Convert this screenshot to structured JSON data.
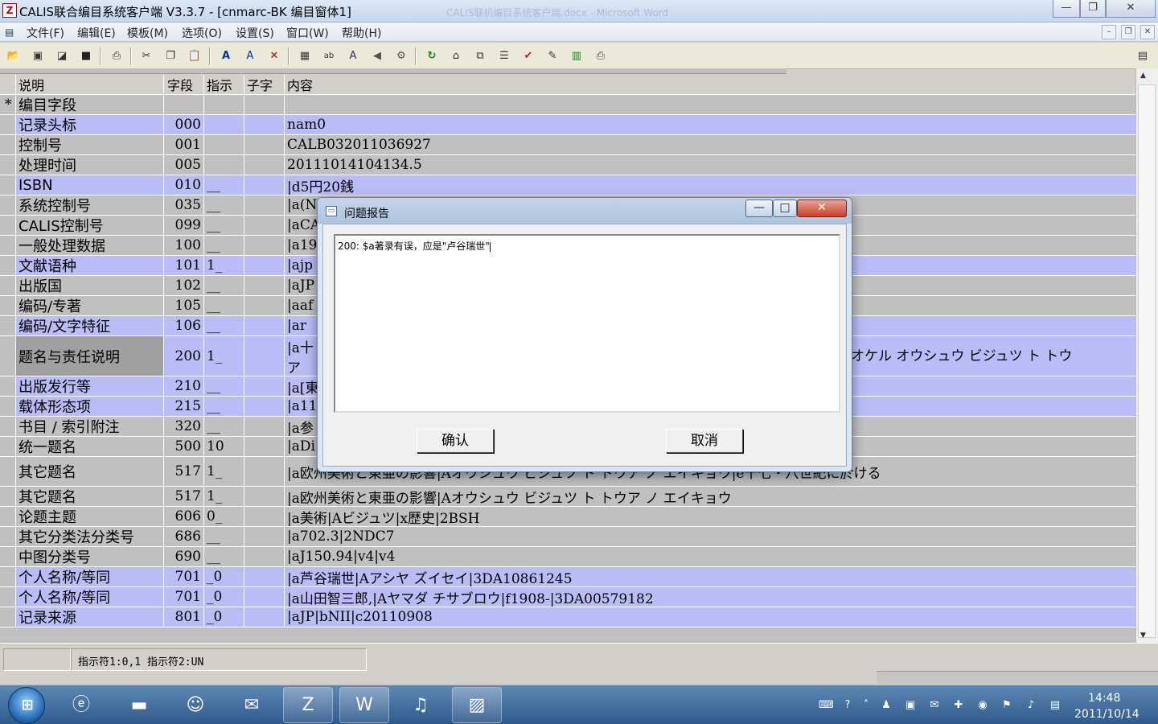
{
  "window": {
    "title": "CALIS联合编目系统客户端 V3.3.7 - [cnmarc-BK 编目窗体1]",
    "ghost_title": "CALIS联机编目系统客户端.docx - Microsoft Word",
    "minimize": "—",
    "maximize": "❐",
    "close": "✕"
  },
  "menu": {
    "items": [
      "文件(F)",
      "编辑(E)",
      "模板(M)",
      "选项(O)",
      "设置(S)",
      "窗口(W)",
      "帮助(H)"
    ]
  },
  "grid": {
    "headers": {
      "ind": "",
      "desc": "说明",
      "field": "字段",
      "indicator": "指示",
      "sub": "子字",
      "content": "内容"
    },
    "rows": [
      {
        "mark": "*",
        "desc": "编目字段",
        "field": "",
        "indicator": "",
        "sub": "",
        "content": "",
        "style": "gray"
      },
      {
        "mark": "",
        "desc": "记录头标",
        "field": "000",
        "indicator": "",
        "sub": "",
        "content": "nam0",
        "style": "blue"
      },
      {
        "mark": "",
        "desc": "控制号",
        "field": "001",
        "indicator": "",
        "sub": "",
        "content": "CALB032011036927",
        "style": "gray"
      },
      {
        "mark": "",
        "desc": "处理时间",
        "field": "005",
        "indicator": "",
        "sub": "",
        "content": "20111014104134.5",
        "style": "gray"
      },
      {
        "mark": "",
        "desc": "ISBN",
        "field": "010",
        "indicator": "__",
        "sub": "",
        "content": "|d5円20銭",
        "style": "blue"
      },
      {
        "mark": "",
        "desc": "系统控制号",
        "field": "035",
        "indicator": "__",
        "sub": "",
        "content": "|a(N",
        "style": "gray"
      },
      {
        "mark": "",
        "desc": "CALIS控制号",
        "field": "099",
        "indicator": "__",
        "sub": "",
        "content": "|aCA",
        "style": "gray"
      },
      {
        "mark": "",
        "desc": "一般处理数据",
        "field": "100",
        "indicator": "__",
        "sub": "",
        "content": "|a19",
        "style": "gray"
      },
      {
        "mark": "",
        "desc": "文献语种",
        "field": "101",
        "indicator": "1_",
        "sub": "",
        "content": "|ajp",
        "style": "blue"
      },
      {
        "mark": "",
        "desc": "出版国",
        "field": "102",
        "indicator": "__",
        "sub": "",
        "content": "|aJP",
        "style": "gray"
      },
      {
        "mark": "",
        "desc": "编码/专著",
        "field": "105",
        "indicator": "__",
        "sub": "",
        "content": "|aaf",
        "style": "gray"
      },
      {
        "mark": "",
        "desc": "编码/文字特征",
        "field": "106",
        "indicator": "__",
        "sub": "",
        "content": "|ar",
        "style": "blue"
      },
      {
        "mark": "",
        "desc": "题名与责任说明",
        "field": "200",
        "indicator": "1_",
        "sub": "",
        "content": "|a十",
        "content2": "ア",
        "content_right": "オケル オウシュウ ビジュツ ト トウ",
        "style": "blue",
        "selected": true
      },
      {
        "mark": "",
        "desc": "出版发行等",
        "field": "210",
        "indicator": "__",
        "sub": "",
        "content": "|a[東",
        "style": "blue"
      },
      {
        "mark": "",
        "desc": "载体形态项",
        "field": "215",
        "indicator": "__",
        "sub": "",
        "content": "|a11",
        "style": "blue"
      },
      {
        "mark": "",
        "desc": "书目 / 索引附注",
        "field": "320",
        "indicator": "__",
        "sub": "",
        "content": "|a参",
        "style": "gray"
      },
      {
        "mark": "",
        "desc": "统一题名",
        "field": "500",
        "indicator": "10",
        "sub": "",
        "content": "|aDi",
        "style": "gray"
      },
      {
        "mark": "",
        "desc": "其它题名",
        "field": "517",
        "indicator": "1_",
        "sub": "",
        "content": "|a欧州美術と東亜の影響|Aオウシュウ ビジュツ ト トウア ノ エイキョウ|e十七・八世紀に於ける",
        "style": "gray"
      },
      {
        "mark": "",
        "desc": "其它题名",
        "field": "517",
        "indicator": "1_",
        "sub": "",
        "content": "|a欧州美術と東亜の影響|Aオウシュウ ビジュツ ト トウア ノ エイキョウ",
        "style": "gray"
      },
      {
        "mark": "",
        "desc": "论题主题",
        "field": "606",
        "indicator": "0_",
        "sub": "",
        "content": "|a美術|Aビジュツ|x歴史|2BSH",
        "style": "gray"
      },
      {
        "mark": "",
        "desc": "其它分类法分类号",
        "field": "686",
        "indicator": "__",
        "sub": "",
        "content": "|a702.3|2NDC7",
        "style": "gray"
      },
      {
        "mark": "",
        "desc": "中图分类号",
        "field": "690",
        "indicator": "__",
        "sub": "",
        "content": "|aJ150.94|v4|v4",
        "style": "gray"
      },
      {
        "mark": "",
        "desc": "个人名称/等同",
        "field": "701",
        "indicator": "_0",
        "sub": "",
        "content": "|a芦谷瑞世|Aアシヤ ズイセイ|3DA10861245",
        "style": "blue"
      },
      {
        "mark": "",
        "desc": "个人名称/等同",
        "field": "701",
        "indicator": "_0",
        "sub": "",
        "content": "|a山田智三郎,|Aヤマダ チサブロウ|f1908-|3DA00579182",
        "style": "blue"
      },
      {
        "mark": "",
        "desc": "记录来源",
        "field": "801",
        "indicator": "_0",
        "sub": "",
        "content": "|aJP|bNII|c20110908",
        "style": "blue"
      }
    ]
  },
  "status": {
    "indicators": "指示符1:0,1 指示符2:UN"
  },
  "dialog": {
    "title": "问题报告",
    "message": "200: $a著录有误，应是\"卢谷瑞世\"",
    "ok": "确认",
    "cancel": "取消",
    "minimize": "—",
    "maximize": "□",
    "close": "✕"
  },
  "taskbar": {
    "time": "14:48",
    "date": "2011/10/14"
  },
  "colors": {
    "row_blue": "#b8bdf6",
    "row_gray": "#c0c0c0",
    "taskbar": "#2f5a8c"
  }
}
